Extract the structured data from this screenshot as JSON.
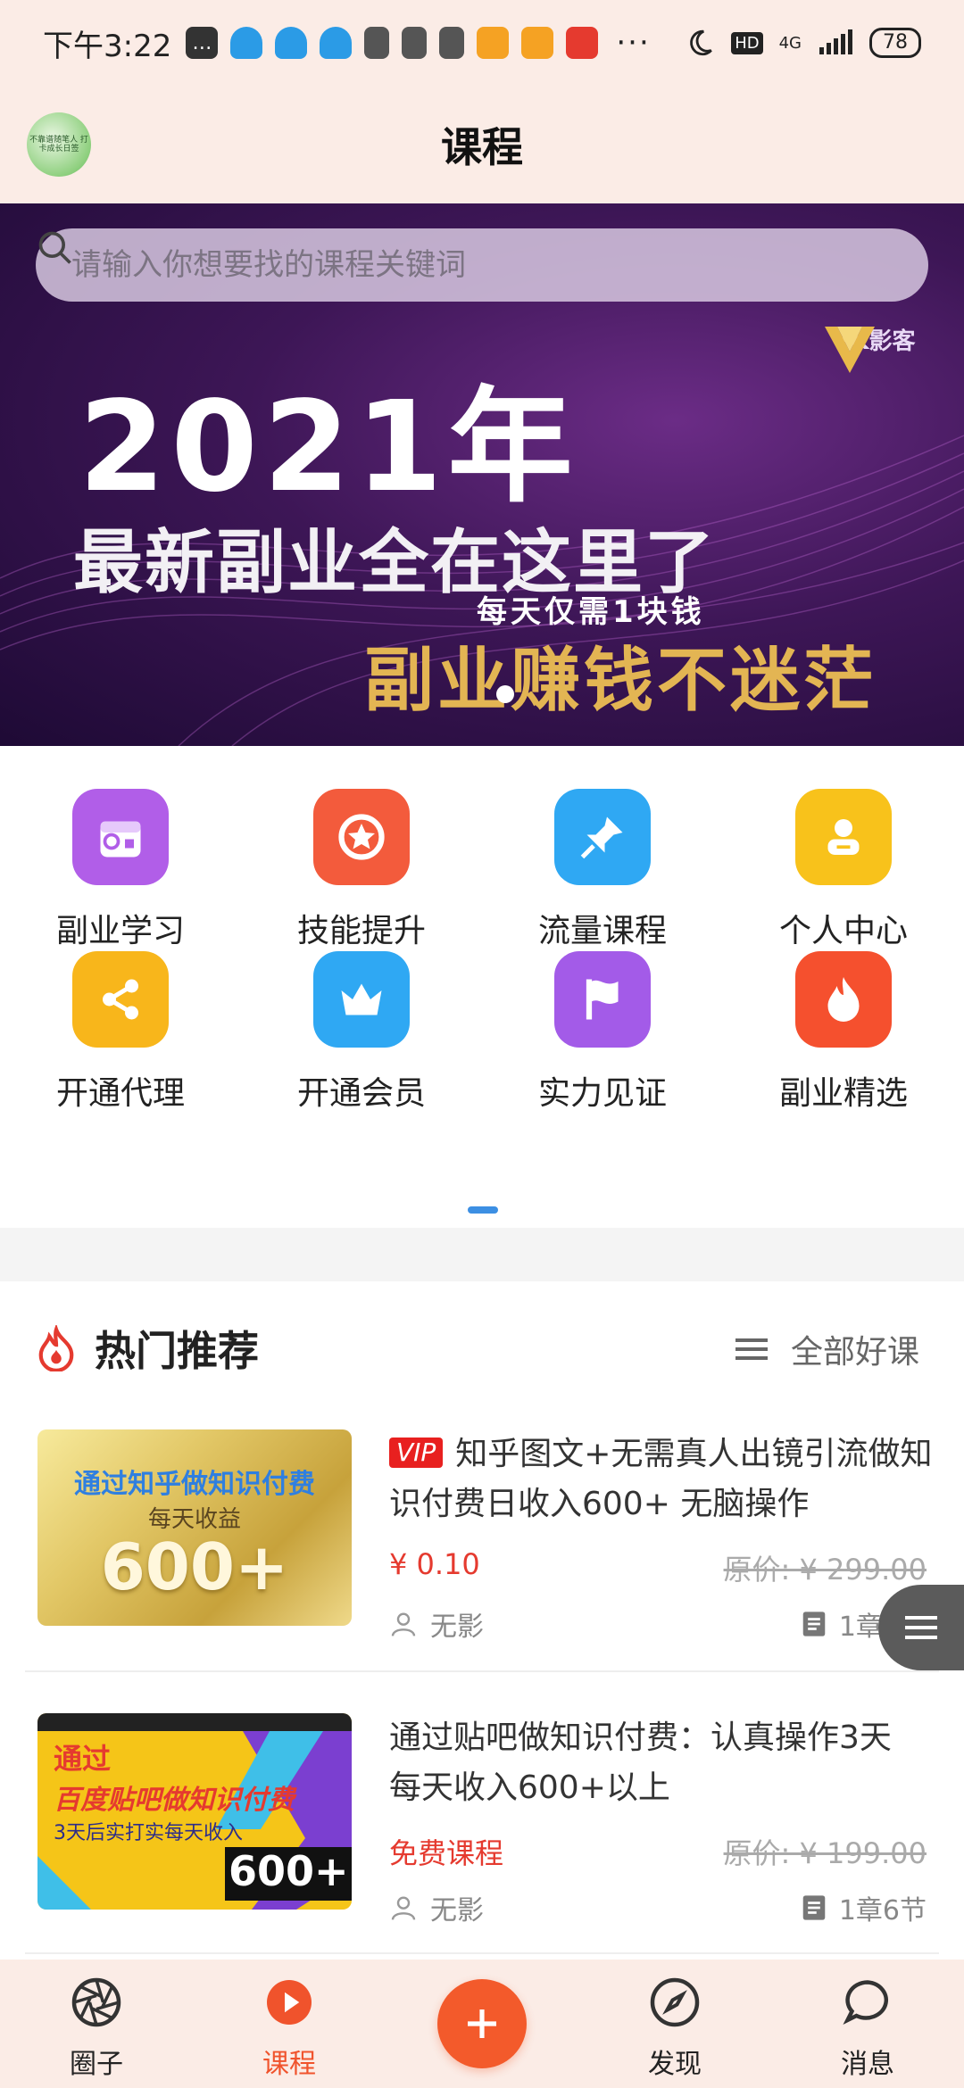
{
  "status_bar": {
    "time": "下午3:22",
    "network": "4G",
    "hd": "HD",
    "battery": "78",
    "more": "···"
  },
  "header": {
    "title": "课程",
    "avatar_text": "不靠谱随笔人 打卡成长日签"
  },
  "banner": {
    "search_placeholder": "请输入你想要找的课程关键词",
    "year_text": "2021年",
    "headline": "最新副业全在这里了",
    "sub": "每天仅需1块钱",
    "gold_text": "副业赚钱不迷茫",
    "logo_text": "YK影客"
  },
  "categories": [
    {
      "label": "副业学习",
      "icon": "calendar-icon",
      "color": "#b15ee8"
    },
    {
      "label": "技能提升",
      "icon": "star-badge-icon",
      "color": "#f35b3c"
    },
    {
      "label": "流量课程",
      "icon": "pin-icon",
      "color": "#2fa8f3"
    },
    {
      "label": "个人中心",
      "icon": "person-card-icon",
      "color": "#f8c21b"
    },
    {
      "label": "开通代理",
      "icon": "share-icon",
      "color": "#f8b61b"
    },
    {
      "label": "开通会员",
      "icon": "crown-icon",
      "color": "#2fa8f3"
    },
    {
      "label": "实力见证",
      "icon": "flag-icon",
      "color": "#a35be8"
    },
    {
      "label": "副业精选",
      "icon": "fire-icon",
      "color": "#f5502e"
    }
  ],
  "hot": {
    "title": "热门推荐",
    "all_label": "全部好课",
    "courses": [
      {
        "vip": "VIP",
        "title": "知乎图文+无需真人出镜引流做知识付费日收入600+ 无脑操作",
        "price": "¥ 0.10",
        "original": "原价: ¥ 299.00",
        "author": "无影",
        "chapters": "1章7节",
        "thumb_line1": "通过知乎做知识付费",
        "thumb_line2": "每天收益",
        "thumb_line3": "600+"
      },
      {
        "title": "通过贴吧做知识付费：认真操作3天 每天收入600+以上",
        "price": "免费课程",
        "original": "原价: ¥ 199.00",
        "author": "无影",
        "chapters": "1章6节",
        "thumb_line1": "通过",
        "thumb_line2": "百度贴吧做知识付费",
        "thumb_line3": "3天后实打实每天收入",
        "thumb_line4": "600+"
      }
    ]
  },
  "bottom_nav": [
    {
      "label": "圈子",
      "icon": "aperture-icon"
    },
    {
      "label": "课程",
      "icon": "play-circle-icon",
      "active": true
    },
    {
      "label": "发现",
      "icon": "compass-icon"
    },
    {
      "label": "消息",
      "icon": "chat-bubble-icon"
    }
  ],
  "colors": {
    "accent": "#f0532c",
    "header_bg": "#fbece6",
    "price_red": "#e53a2f"
  }
}
